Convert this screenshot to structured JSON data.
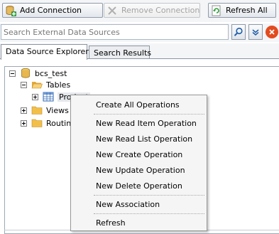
{
  "toolbar": {
    "add_connection": "Add Connection",
    "remove_connection": "Remove Connection",
    "refresh_all": "Refresh All"
  },
  "search": {
    "placeholder": "Search External Data Sources"
  },
  "tabs": [
    {
      "label": "Data Source Explorer",
      "active": true
    },
    {
      "label": "Search Results",
      "active": false
    }
  ],
  "tree": {
    "root": "bcs_test",
    "tables": "Tables",
    "table_item": "Product",
    "views": "Views",
    "routines": "Routines"
  },
  "context_menu": {
    "items": [
      "Create All Operations",
      "New Read Item Operation",
      "New Read List Operation",
      "New Create Operation",
      "New Update Operation",
      "New Delete Operation",
      "New Association",
      "Refresh"
    ]
  },
  "colors": {
    "accent": "#1f5fa8",
    "folder": "#f2c04a",
    "delete": "#e14b1f"
  }
}
